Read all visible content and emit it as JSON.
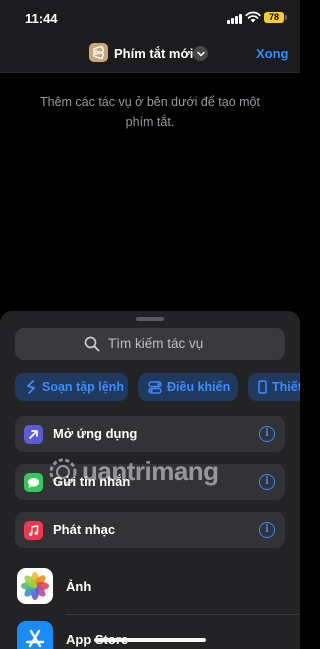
{
  "status": {
    "time": "11:44",
    "battery": "78"
  },
  "nav": {
    "title": "Phím tắt mới",
    "done": "Xong"
  },
  "hint": "Thêm các tác vụ ở bên dưới để tạo một phím tắt.",
  "search": {
    "placeholder": "Tìm kiếm tác vụ"
  },
  "chips": [
    {
      "label": "Soạn tập lệnh"
    },
    {
      "label": "Điều khiển"
    },
    {
      "label": "Thiết"
    }
  ],
  "suggestions": [
    {
      "label": "Mở ứng dụng",
      "icon": "arrow-up-right-icon",
      "color": "#5a5bd6"
    },
    {
      "label": "Gửi tin nhắn",
      "icon": "messages-icon",
      "color": "#34c759"
    },
    {
      "label": "Phát nhạc",
      "icon": "music-note-icon",
      "color": "#fa3350"
    }
  ],
  "apps": [
    {
      "label": "Ảnh",
      "icon": "photos-icon"
    },
    {
      "label": "App Store",
      "icon": "app-store-icon"
    }
  ],
  "watermark": {
    "text": "uantrimang"
  },
  "colors": {
    "accent": "#2f8cff",
    "battery": "#f6cf2a",
    "sheet": "#232325"
  }
}
